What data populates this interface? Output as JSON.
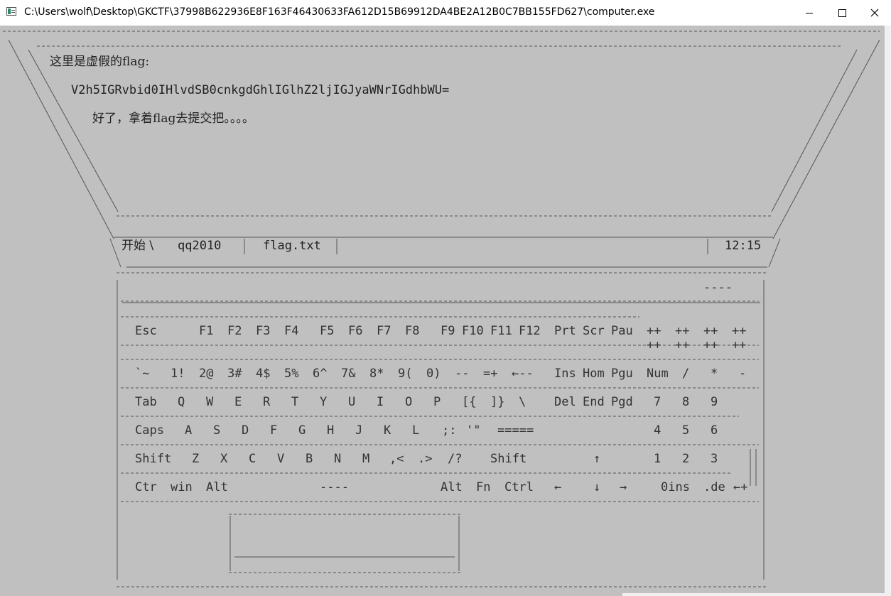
{
  "window": {
    "title": "C:\\Users\\wolf\\Desktop\\GKCTF\\37998B622936E8F163F46430633FA612D15B69912DA4BE2A12B0C7BB155FD627\\computer.exe"
  },
  "screen": {
    "line1": "这里是虚假的flag:",
    "line2": "V2h5IGRvbid0IHlvdSB0cnkgdGhlIGlhZ2ljIGJyaWNrIGdhbWU=",
    "line3": "好了，拿着flag去提交把。。。。"
  },
  "taskbar": {
    "start": "开始 \\",
    "item1": "qq2010",
    "item2": "flag.txt",
    "clock": "12:15"
  },
  "keyboard": {
    "top_mark": "----",
    "row_fn": [
      "Esc",
      "F1",
      "F2",
      "F3",
      "F4",
      "F5",
      "F6",
      "F7",
      "F8",
      "F9",
      "F10",
      "F11",
      "F12",
      "Prt",
      "Scr",
      "Pau",
      "++",
      "++",
      "++",
      "++"
    ],
    "row_fn_b": [
      "++",
      "++",
      "++",
      "++"
    ],
    "row_num": [
      "`~",
      "1!",
      "2@",
      "3#",
      "4$",
      "5%",
      "6^",
      "7&",
      "8*",
      "9(",
      "0)",
      "--",
      "=+",
      "←--",
      "Ins",
      "Hom",
      "Pgu",
      "Num",
      "/",
      "*",
      "-"
    ],
    "row_q": [
      "Tab",
      "Q",
      "W",
      "E",
      "R",
      "T",
      "Y",
      "U",
      "I",
      "O",
      "P",
      "[{",
      "]}",
      "\\",
      "Del",
      "End",
      "Pgd",
      "7",
      "8",
      "9"
    ],
    "row_a": [
      "Caps",
      "A",
      "S",
      "D",
      "F",
      "G",
      "H",
      "J",
      "K",
      "L",
      ";:",
      "'\"",
      "=====",
      "4",
      "5",
      "6"
    ],
    "row_z": [
      "Shift",
      "Z",
      "X",
      "C",
      "V",
      "B",
      "N",
      "M",
      ",<",
      ".>",
      "/?",
      "Shift",
      "↑",
      "1",
      "2",
      "3"
    ],
    "row_ctrl": [
      "Ctr",
      "win",
      "Alt",
      "----",
      "Alt",
      "Fn",
      "Ctrl",
      "←",
      "↓",
      "→",
      "0ins",
      ".de",
      "←+"
    ]
  }
}
